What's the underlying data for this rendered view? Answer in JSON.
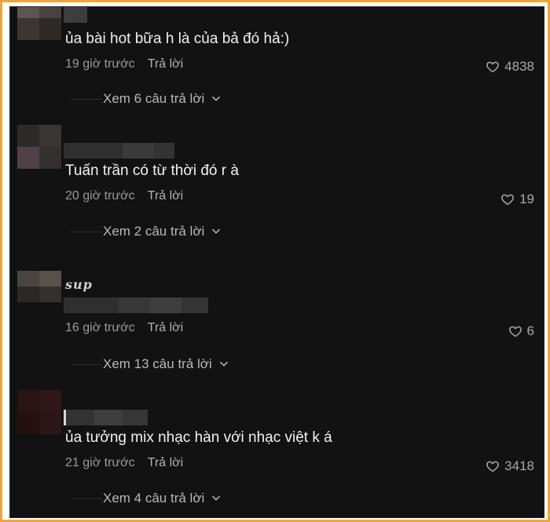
{
  "comments": [
    {
      "handle": "",
      "text": "ủa bài hot bữa h là của bả đó hả:)",
      "time": "19 giờ trước",
      "reply_label": "Trả lời",
      "likes": "4838",
      "view_replies": "Xem 6 câu trả lời",
      "avatar_colors": [
        "#5e5452",
        "#4a4240",
        "#3b3533",
        "#2f2a28"
      ]
    },
    {
      "handle": "",
      "text": "Tuấn trần có từ thời đó r à",
      "time": "20 giờ trước",
      "reply_label": "Trả lời",
      "likes": "19",
      "view_replies": "Xem 2 câu trả lời",
      "avatar_colors": [
        "#2e2a2a",
        "#3a3434",
        "#4e4147",
        "#343030"
      ]
    },
    {
      "handle": "sup",
      "text": "",
      "time": "16 giờ trước",
      "reply_label": "Trả lời",
      "likes": "6",
      "view_replies": "Xem 13 câu trả lời",
      "avatar_colors": [
        "#4b4542",
        "#5a504c",
        "#2b2826",
        "#33302e"
      ]
    },
    {
      "handle": "",
      "text": "ủa tưởng mix nhạc hàn với nhạc việt k á",
      "time": "21 giờ trước",
      "reply_label": "Trả lời",
      "likes": "3418",
      "view_replies": "Xem 4 câu trả lời",
      "avatar_colors": [
        "#2a1416",
        "#2f1719",
        "#24110f",
        "#2c1618"
      ]
    }
  ],
  "colors": {
    "frame": "#f2a533",
    "panel": "#121212",
    "text": "#f1f1f1",
    "muted": "#9a9a9a"
  },
  "icons": {
    "like": "heart-outline-icon",
    "expand": "chevron-down-icon"
  }
}
